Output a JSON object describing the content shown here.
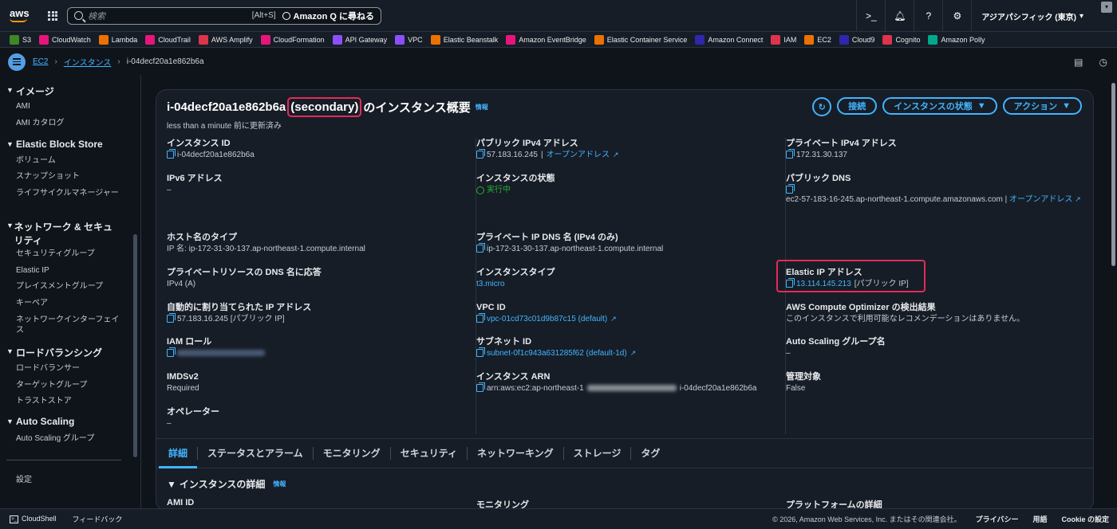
{
  "topbar": {
    "logo": "aws",
    "search_placeholder": "検索",
    "search_shortcut": "[Alt+S]",
    "amazon_q": "Amazon Q に尋ねる",
    "region": "アジアパシフィック (東京)"
  },
  "favorites": [
    {
      "label": "S3",
      "color": "#3f8624"
    },
    {
      "label": "CloudWatch",
      "color": "#e7157b"
    },
    {
      "label": "Lambda",
      "color": "#ed7100"
    },
    {
      "label": "CloudTrail",
      "color": "#e7157b"
    },
    {
      "label": "AWS Amplify",
      "color": "#dd344c"
    },
    {
      "label": "CloudFormation",
      "color": "#e7157b"
    },
    {
      "label": "API Gateway",
      "color": "#8c4fff"
    },
    {
      "label": "VPC",
      "color": "#8c4fff"
    },
    {
      "label": "Elastic Beanstalk",
      "color": "#ed7100"
    },
    {
      "label": "Amazon EventBridge",
      "color": "#e7157b"
    },
    {
      "label": "Elastic Container Service",
      "color": "#ed7100"
    },
    {
      "label": "Amazon Connect",
      "color": "#2e27ad"
    },
    {
      "label": "IAM",
      "color": "#dd344c"
    },
    {
      "label": "EC2",
      "color": "#ed7100"
    },
    {
      "label": "Cloud9",
      "color": "#2e27ad"
    },
    {
      "label": "Cognito",
      "color": "#dd344c"
    },
    {
      "label": "Amazon Polly",
      "color": "#01a88d"
    }
  ],
  "breadcrumb": [
    "EC2",
    "インスタンス",
    "i-04decf20a1e862b6a"
  ],
  "sidebar": {
    "sections": [
      {
        "title": "イメージ",
        "items": [
          "AMI",
          "AMI カタログ"
        ]
      },
      {
        "title": "Elastic Block Store",
        "items": [
          "ボリューム",
          "スナップショット",
          "ライフサイクルマネージャー"
        ]
      },
      {
        "title": "ネットワーク & セキュリティ",
        "items": [
          "セキュリティグループ",
          "Elastic IP",
          "プレイスメントグループ",
          "キーペア",
          "ネットワークインターフェイス"
        ]
      },
      {
        "title": "ロードバランシング",
        "items": [
          "ロードバランサー",
          "ターゲットグループ",
          "トラストストア"
        ]
      },
      {
        "title": "Auto Scaling",
        "items": [
          "Auto Scaling グループ"
        ]
      }
    ],
    "settings": "設定"
  },
  "panel": {
    "title_id": "i-04decf20a1e862b6a",
    "title_tag": "(secondary)",
    "title_suffix": "のインスタンス概要",
    "info": "情報",
    "updated": "less than a minute 前に更新済み",
    "buttons": {
      "connect": "接続",
      "state": "インスタンスの状態",
      "actions": "アクション"
    }
  },
  "col1": {
    "instance_id": {
      "label": "インスタンス ID",
      "value": "i-04decf20a1e862b6a"
    },
    "ipv6": {
      "label": "IPv6 アドレス",
      "value": "–"
    },
    "hostname_type": {
      "label": "ホスト名のタイプ",
      "value": "IP 名: ip-172-31-30-137.ap-northeast-1.compute.internal"
    },
    "dns_reply": {
      "label": "プライベートリソースの DNS 名に応答",
      "value": "IPv4 (A)"
    },
    "auto_ip": {
      "label": "自動的に割り当てられた IP アドレス",
      "value": "57.183.16.245 [パブリック IP]"
    },
    "iam_role": {
      "label": "IAM ロール"
    },
    "imdsv2": {
      "label": "IMDSv2",
      "value": "Required"
    },
    "operator": {
      "label": "オペレーター",
      "value": "–"
    }
  },
  "col2": {
    "public_ipv4": {
      "label": "パブリック IPv4 アドレス",
      "value": "57.183.16.245",
      "link": "オープンアドレス"
    },
    "state": {
      "label": "インスタンスの状態",
      "value": "実行中"
    },
    "private_dns": {
      "label": "プライベート IP DNS 名 (IPv4 のみ)",
      "value": "ip-172-31-30-137.ap-northeast-1.compute.internal"
    },
    "type": {
      "label": "インスタンスタイプ",
      "value": "t3.micro"
    },
    "vpc": {
      "label": "VPC ID",
      "value": "vpc-01cd73c01d9b87c15 (default)"
    },
    "subnet": {
      "label": "サブネット ID",
      "value": "subnet-0f1c943a631285f62 (default-1d)"
    },
    "arn": {
      "label": "インスタンス ARN",
      "prefix": "arn:aws:ec2:ap-northeast-1",
      "suffix": "i-04decf20a1e862b6a"
    }
  },
  "col3": {
    "private_ipv4": {
      "label": "プライベート IPv4 アドレス",
      "value": "172.31.30.137"
    },
    "public_dns": {
      "label": "パブリック DNS",
      "value": "ec2-57-183-16-245.ap-northeast-1.compute.amazonaws.com",
      "link": "オープンアドレス"
    },
    "elastic_ip": {
      "label": "Elastic IP アドレス",
      "value": "13.114.145.213",
      "note": "[パブリック IP]"
    },
    "optimizer": {
      "label": "AWS Compute Optimizer の検出結果",
      "value": "このインスタンスで利用可能なレコメンデーションはありません。"
    },
    "asg": {
      "label": "Auto Scaling グループ名",
      "value": "–"
    },
    "managed": {
      "label": "管理対象",
      "value": "False"
    }
  },
  "tabs": [
    "詳細",
    "ステータスとアラーム",
    "モニタリング",
    "セキュリティ",
    "ネットワーキング",
    "ストレージ",
    "タグ"
  ],
  "details": {
    "heading": "インスタンスの詳細",
    "info": "情報",
    "ami_label": "AMI ID",
    "monitoring_label": "モニタリング",
    "platform_label": "プラットフォームの詳細"
  },
  "footer": {
    "cloudshell": "CloudShell",
    "feedback": "フィードバック",
    "copyright": "© 2026, Amazon Web Services, Inc. またはその関連会社。",
    "privacy": "プライバシー",
    "terms": "用語",
    "cookie": "Cookie の設定"
  }
}
